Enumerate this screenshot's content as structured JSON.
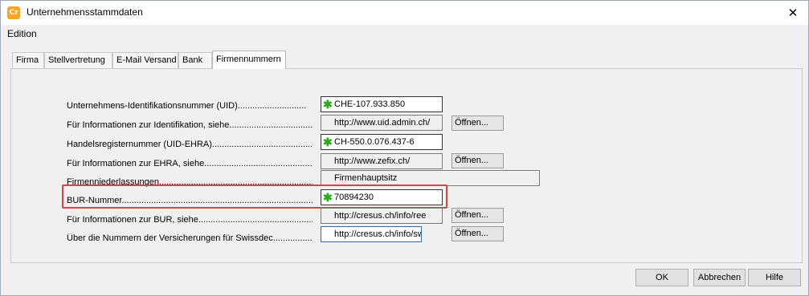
{
  "window": {
    "title": "Unternehmensstammdaten",
    "app_icon_glyph": "Cr",
    "close_glyph": "✕"
  },
  "menu": {
    "edition": "Edition"
  },
  "tabs": [
    {
      "label": "Firma"
    },
    {
      "label": "Stellvertretung"
    },
    {
      "label": "E-Mail Versand"
    },
    {
      "label": "Bank"
    },
    {
      "label": "Firmennummern"
    }
  ],
  "active_tab": "Firmennummern",
  "fields": {
    "uid": {
      "label": "Unternehmens-Identifikationsnummer (UID)............................",
      "value": "CHE-107.933.850"
    },
    "uid_info": {
      "label": "Für Informationen zur Identifikation, siehe..................................",
      "value": "http://www.uid.admin.ch/"
    },
    "ehra": {
      "label": "Handelsregisternummer (UID-EHRA)...................................................",
      "value": "CH-550.0.076.437-6"
    },
    "ehra_info": {
      "label": "Für Informationen zur EHRA, siehe......................................................",
      "value": "http://www.zefix.ch/"
    },
    "branches": {
      "label": "Firmenniederlassungen.................................................................................",
      "value": "Firmenhauptsitz"
    },
    "bur": {
      "label": "BUR-Nummer............................................................................................................",
      "value": "70894230"
    },
    "bur_info": {
      "label": "Für Informationen zur BUR, siehe.............................................................",
      "value": "http://cresus.ch/info/ree"
    },
    "swissdec": {
      "label": "Über die Nummern der Versicherungen für Swissdec...........................",
      "value": "http://cresus.ch/info/sw-"
    }
  },
  "star_glyph": "✱",
  "open_button_label": "Öffnen...",
  "buttons": {
    "ok": "OK",
    "cancel": "Abbrechen",
    "help": "Hilfe"
  },
  "colors": {
    "required_star": "#2ea81c",
    "highlight_border": "#e04040"
  }
}
